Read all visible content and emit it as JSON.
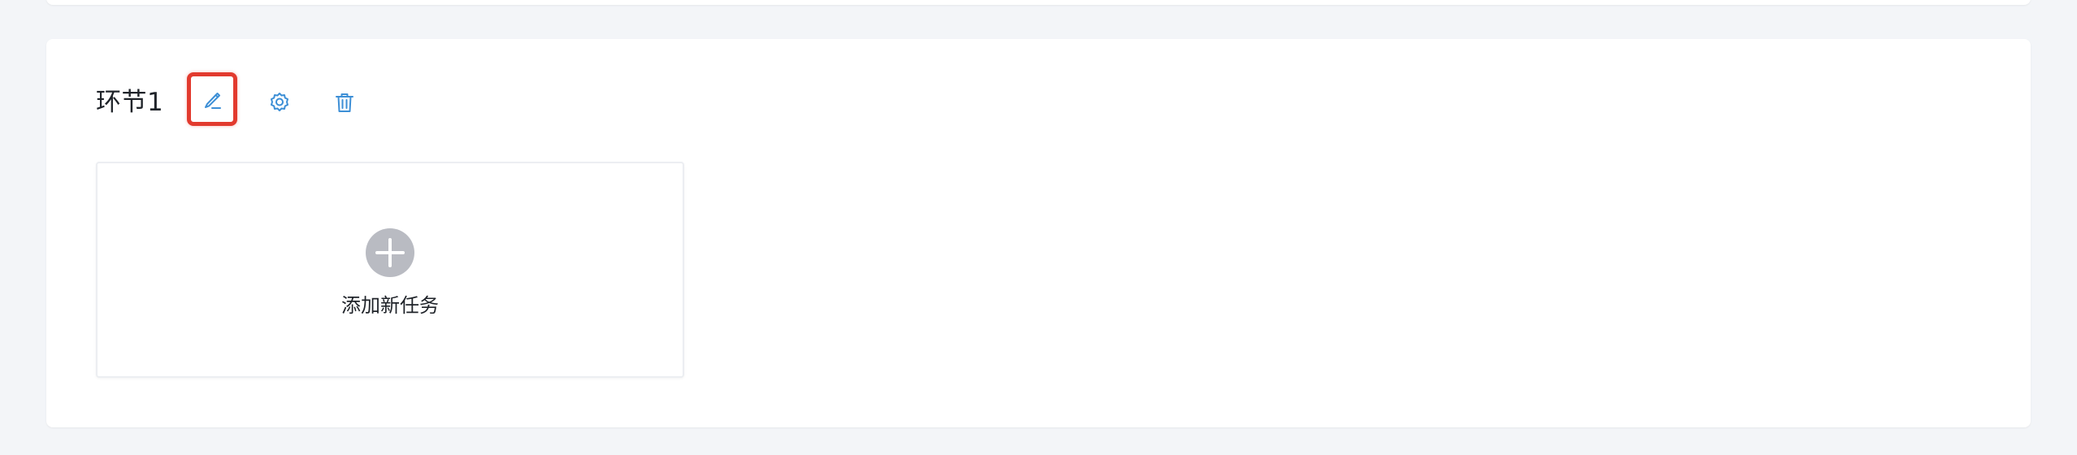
{
  "stage": {
    "title": "环节1"
  },
  "toolbar": {
    "edit_icon": "pen-edit-icon",
    "settings_icon": "gear-icon",
    "delete_icon": "trash-icon",
    "highlight_color": "#e23a2e",
    "icon_color": "#3d8fd6"
  },
  "task_card": {
    "add_label": "添加新任务",
    "add_icon": "plus-circle-icon"
  }
}
